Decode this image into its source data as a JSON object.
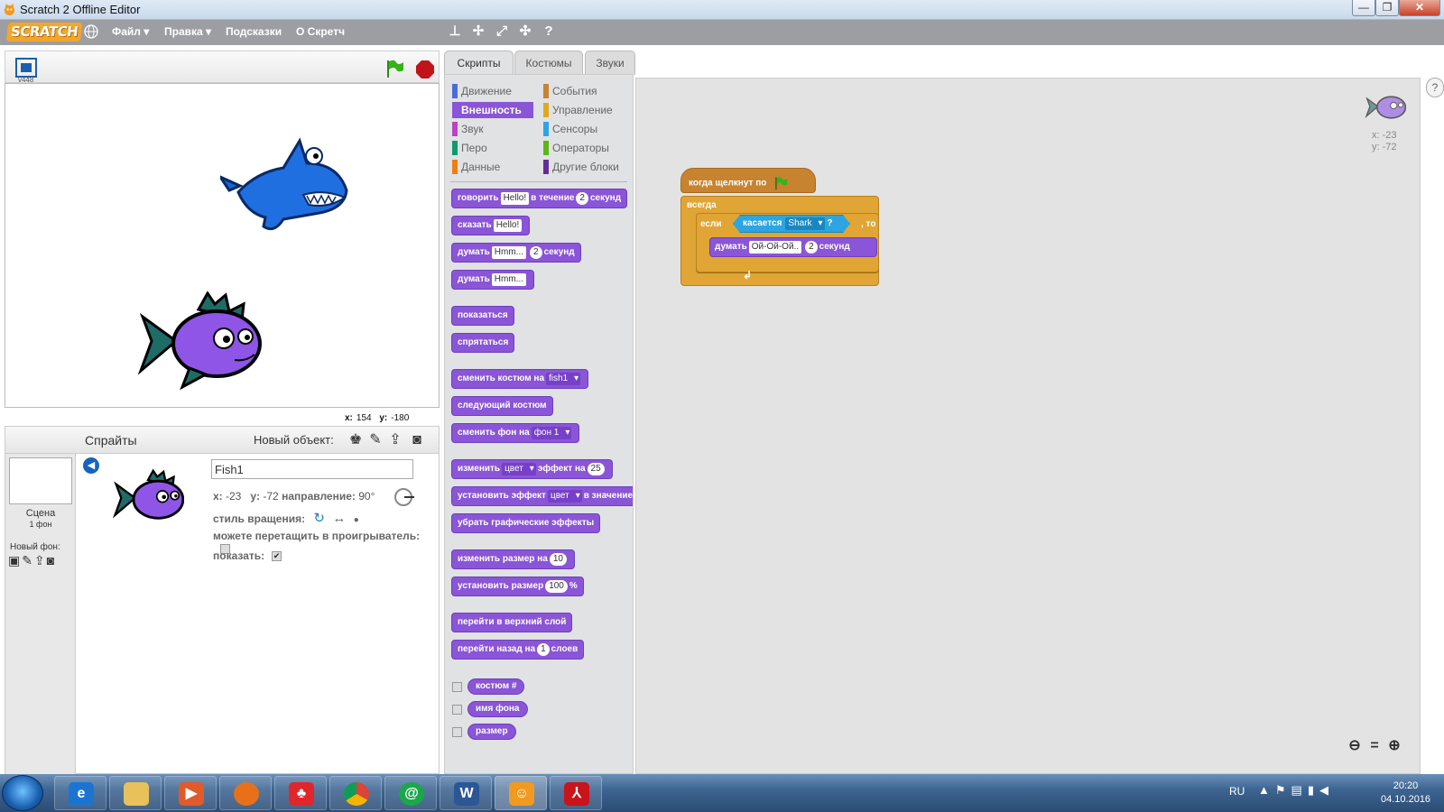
{
  "window": {
    "title": "Scratch 2 Offline Editor",
    "min": "—",
    "max": "❐",
    "close": "✕"
  },
  "menubar": {
    "logo": "SCRATCH",
    "items": [
      {
        "label": "Файл ▾"
      },
      {
        "label": "Правка ▾"
      },
      {
        "label": "Подсказки"
      },
      {
        "label": "О Скретч"
      }
    ]
  },
  "stage": {
    "version": "v448",
    "mouse_x_label": "x:",
    "mouse_x": "154",
    "mouse_y_label": "y:",
    "mouse_y": "-180"
  },
  "sprites": {
    "title": "Спрайты",
    "new_object_label": "Новый объект:",
    "scene_label": "Сцена",
    "scene_backdrops": "1 фон",
    "new_backdrop_label": "Новый фон:",
    "selected": {
      "name": "Fish1",
      "x_label": "x:",
      "x": "-23",
      "y_label": "y:",
      "y": "-72",
      "direction_label": "направление:",
      "direction": "90°",
      "rotation_style_label": "стиль вращения:",
      "draggable_label": "можете перетащить в проигрыватель:",
      "show_label": "показать:"
    }
  },
  "tabs": [
    {
      "label": "Скрипты"
    },
    {
      "label": "Костюмы"
    },
    {
      "label": "Звуки"
    }
  ],
  "categories": {
    "left": [
      {
        "label": "Движение",
        "color": "#4a6cd4"
      },
      {
        "label": "Внешность",
        "color": "#8a55d7"
      },
      {
        "label": "Звук",
        "color": "#bb42c3"
      },
      {
        "label": "Перо",
        "color": "#0e9a6c"
      },
      {
        "label": "Данные",
        "color": "#ee7d16"
      }
    ],
    "right": [
      {
        "label": "События",
        "color": "#c88330"
      },
      {
        "label": "Управление",
        "color": "#e1a91a"
      },
      {
        "label": "Сенсоры",
        "color": "#2ca5e2"
      },
      {
        "label": "Операторы",
        "color": "#5cb712"
      },
      {
        "label": "Другие блоки",
        "color": "#632d99"
      }
    ]
  },
  "palette": {
    "say_for": {
      "a": "говорить",
      "v1": "Hello!",
      "b": "в течение",
      "v2": "2",
      "c": "секунд"
    },
    "say": {
      "a": "сказать",
      "v1": "Hello!"
    },
    "think_for": {
      "a": "думать",
      "v1": "Hmm...",
      "v2": "2",
      "b": "секунд"
    },
    "think": {
      "a": "думать",
      "v1": "Hmm..."
    },
    "show": "показаться",
    "hide": "спрятаться",
    "switch_costume": {
      "a": "сменить костюм на",
      "v1": "fish1"
    },
    "next_costume": "следующий костюм",
    "switch_backdrop": {
      "a": "сменить фон на",
      "v1": "фон 1"
    },
    "change_effect": {
      "a": "изменить",
      "v1": "цвет",
      "b": "эффект на",
      "v2": "25"
    },
    "set_effect": {
      "a": "установить эффект",
      "v1": "цвет",
      "b": "в значение"
    },
    "clear_effects": "убрать графические эффекты",
    "change_size": {
      "a": "изменить размер на",
      "v1": "10"
    },
    "set_size": {
      "a": "установить размер",
      "v1": "100",
      "b": "%"
    },
    "front": "перейти в верхний слой",
    "back": {
      "a": "перейти назад на",
      "v1": "1",
      "b": "слоев"
    },
    "reporters": [
      {
        "label": "костюм #"
      },
      {
        "label": "имя фона"
      },
      {
        "label": "размер"
      }
    ]
  },
  "script": {
    "hat": "когда щелкнут по",
    "forever": "всегда",
    "if": "если",
    "then": ", то",
    "touching": "касается",
    "touching_target": "Shark",
    "touching_q": "?",
    "think": "думать",
    "think_text": "Ой-Ой-Ой..",
    "think_secs": "2",
    "seconds": "секунд"
  },
  "script_area": {
    "x_label": "x:",
    "x": "-23",
    "y_label": "y:",
    "y": "-72"
  },
  "taskbar": {
    "lang": "RU",
    "time": "20:20",
    "date": "04.10.2016"
  }
}
